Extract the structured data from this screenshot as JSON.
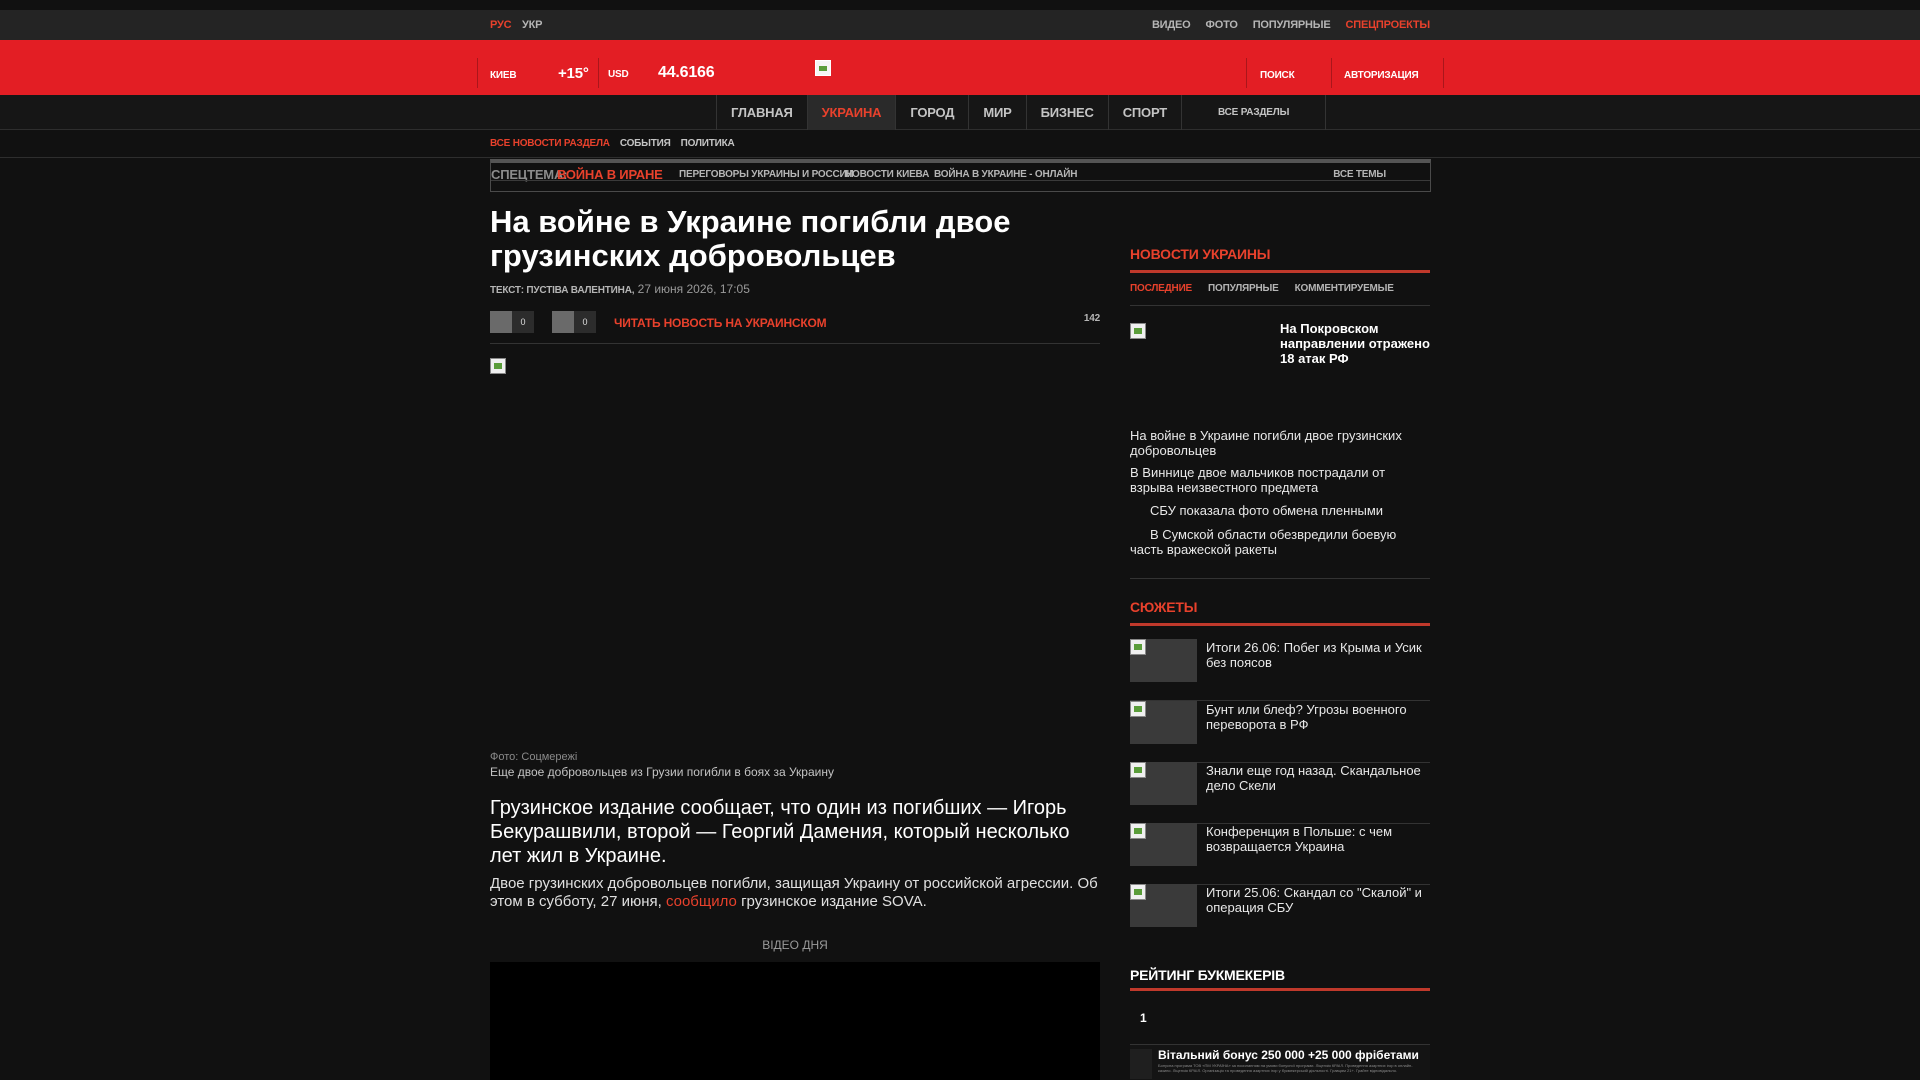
{
  "topbar": {
    "lang_ru": "РУС",
    "lang_ua": "УКР",
    "links": [
      "ВИДЕО",
      "ФОТО",
      "ПОПУЛЯРНЫЕ",
      "СПЕЦПРОЕКТЫ"
    ]
  },
  "header": {
    "city": "КИЕВ",
    "temperature": "+15°",
    "currency": "USD",
    "rate": "44.6166",
    "search": "ПОИСК",
    "auth": "АВТОРИЗАЦИЯ"
  },
  "nav": {
    "tabs": [
      "ГЛАВНАЯ",
      "УКРАИНА",
      "ГОРОД",
      "МИР",
      "БИЗНЕС",
      "СПОРТ"
    ],
    "all_sections": "ВСЕ РАЗДЕЛЫ"
  },
  "subnav": {
    "items": [
      "ВСЕ НОВОСТИ РАЗДЕЛА",
      "СОБЫТИЯ",
      "ПОЛИТИКА"
    ]
  },
  "special_topics": {
    "label": "СПЕЦТЕМА:",
    "hot_topic": "ВОЙНА В ИРАНЕ",
    "topics": [
      "ПЕРЕГОВОРЫ УКРАИНЫ И РОССИИ",
      "НОВОСТИ КИЕВА",
      "ВОЙНА В УКРАИНЕ - ОНЛАЙН"
    ],
    "all_topics": "ВСЕ ТЕМЫ"
  },
  "article": {
    "title": "На войне в Украине погибли двое грузинских добровольцев",
    "author": "ТЕКСТ: ПУСТІВА ВАЛЕНТИНА,",
    "date": "27 июня 2026, 17:05",
    "share_count_1": "0",
    "share_count_2": "0",
    "read_ukrainian": "ЧИТАТЬ НОВОСТЬ НА УКРАИНСКОМ",
    "views": "142",
    "photo_credit": "Фото: Соцмережі",
    "photo_caption": "Еще двое добровольцев из Грузии погибли в боях за Украину",
    "lead": "Грузинское издание сообщает, что один из погибших — Игорь Бекурашвили, второй — Георгий Дамения, который несколько лет жил в Украине.",
    "paragraph_before": "Двое грузинских добровольцев погибли, защищая Украину от российской агрессии. Об этом в субботу, 27 июня,",
    "paragraph_link": "сообщило",
    "paragraph_after": "грузинское издание SOVA.",
    "video_label": "ВІДЕО ДНЯ"
  },
  "sidebar": {
    "news_heading": "НОВОСТИ УКРАИНЫ",
    "news_tabs": [
      "ПОСЛЕДНИЕ",
      "ПОПУЛЯРНЫЕ",
      "КОММЕНТИРУЕМЫЕ"
    ],
    "top_news": "На Покровском направлении отражено 18 атак РФ",
    "news": [
      "На войне в Украине погибли двое грузинских добровольцев",
      "В Виннице двое мальчиков пострадали от взрыва неизвестного предмета",
      "СБУ показала фото обмена пленными",
      "В Сумской области обезвредили боевую часть вражеской ракеты"
    ],
    "stories_heading": "СЮЖЕТЫ",
    "stories": [
      "Итоги 26.06: Побег из Крыма и Усик без поясов",
      "Бунт или блеф? Угрозы военного переворота в РФ",
      "Знали еще год назад. Скандальное дело Скели",
      "Конференция в Польше: с чем возвращается Украина",
      "Итоги 25.06: Скандал со \"Скалой\" и операция СБУ"
    ],
    "bookmakers_heading": "РЕЙТИНГ БУКМЕКЕРІВ",
    "bookmaker_rank": "1",
    "bookmaker_offer": "Вітальний бонус 250 000 +25 000 фрібетами",
    "bookmaker_fine_print": "Бонусна програма ТОВ «ПМ УКРАЇНА» за посиланням на умови бонусної програми. Ліцензія КРАІЛ. Проведення азартних ігор в онлайн-казино. Ліцензія КРАІЛ. Організація та проведення азартних ігор у букмекерській діяльності. Гравцям 21+. Грайте відповідально."
  },
  "colors": {
    "brand_red": "#e31e24",
    "accent_red": "#e8412c",
    "background": "#111111"
  }
}
